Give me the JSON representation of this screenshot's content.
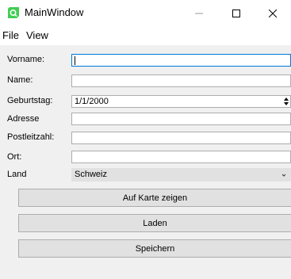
{
  "window": {
    "title": "MainWindow",
    "icon": "qt-app-icon",
    "controls": {
      "minimize": "minimize-icon",
      "maximize": "maximize-icon",
      "close": "close-icon"
    }
  },
  "menu": {
    "items": [
      "File",
      "View"
    ]
  },
  "form": {
    "fields": [
      {
        "label": "Vorname:",
        "value": "",
        "focused": true
      },
      {
        "label": "Name:",
        "value": ""
      },
      {
        "label": "Geburtstag:",
        "value": "1/1/2000"
      },
      {
        "label": "Adresse",
        "value": ""
      },
      {
        "label": "Postleitzahl:",
        "value": ""
      },
      {
        "label": "Ort:",
        "value": ""
      }
    ],
    "country": {
      "label": "Land",
      "selected": "Schweiz"
    }
  },
  "buttons": {
    "show_map": "Auf Karte zeigen",
    "load": "Laden",
    "save": "Speichern"
  },
  "colors": {
    "window_bg": "#f0f0f0",
    "titlebar_bg": "#ffffff",
    "focus_border": "#0078d7",
    "button_bg": "#e1e1e1",
    "icon_green": "#41cd52"
  }
}
